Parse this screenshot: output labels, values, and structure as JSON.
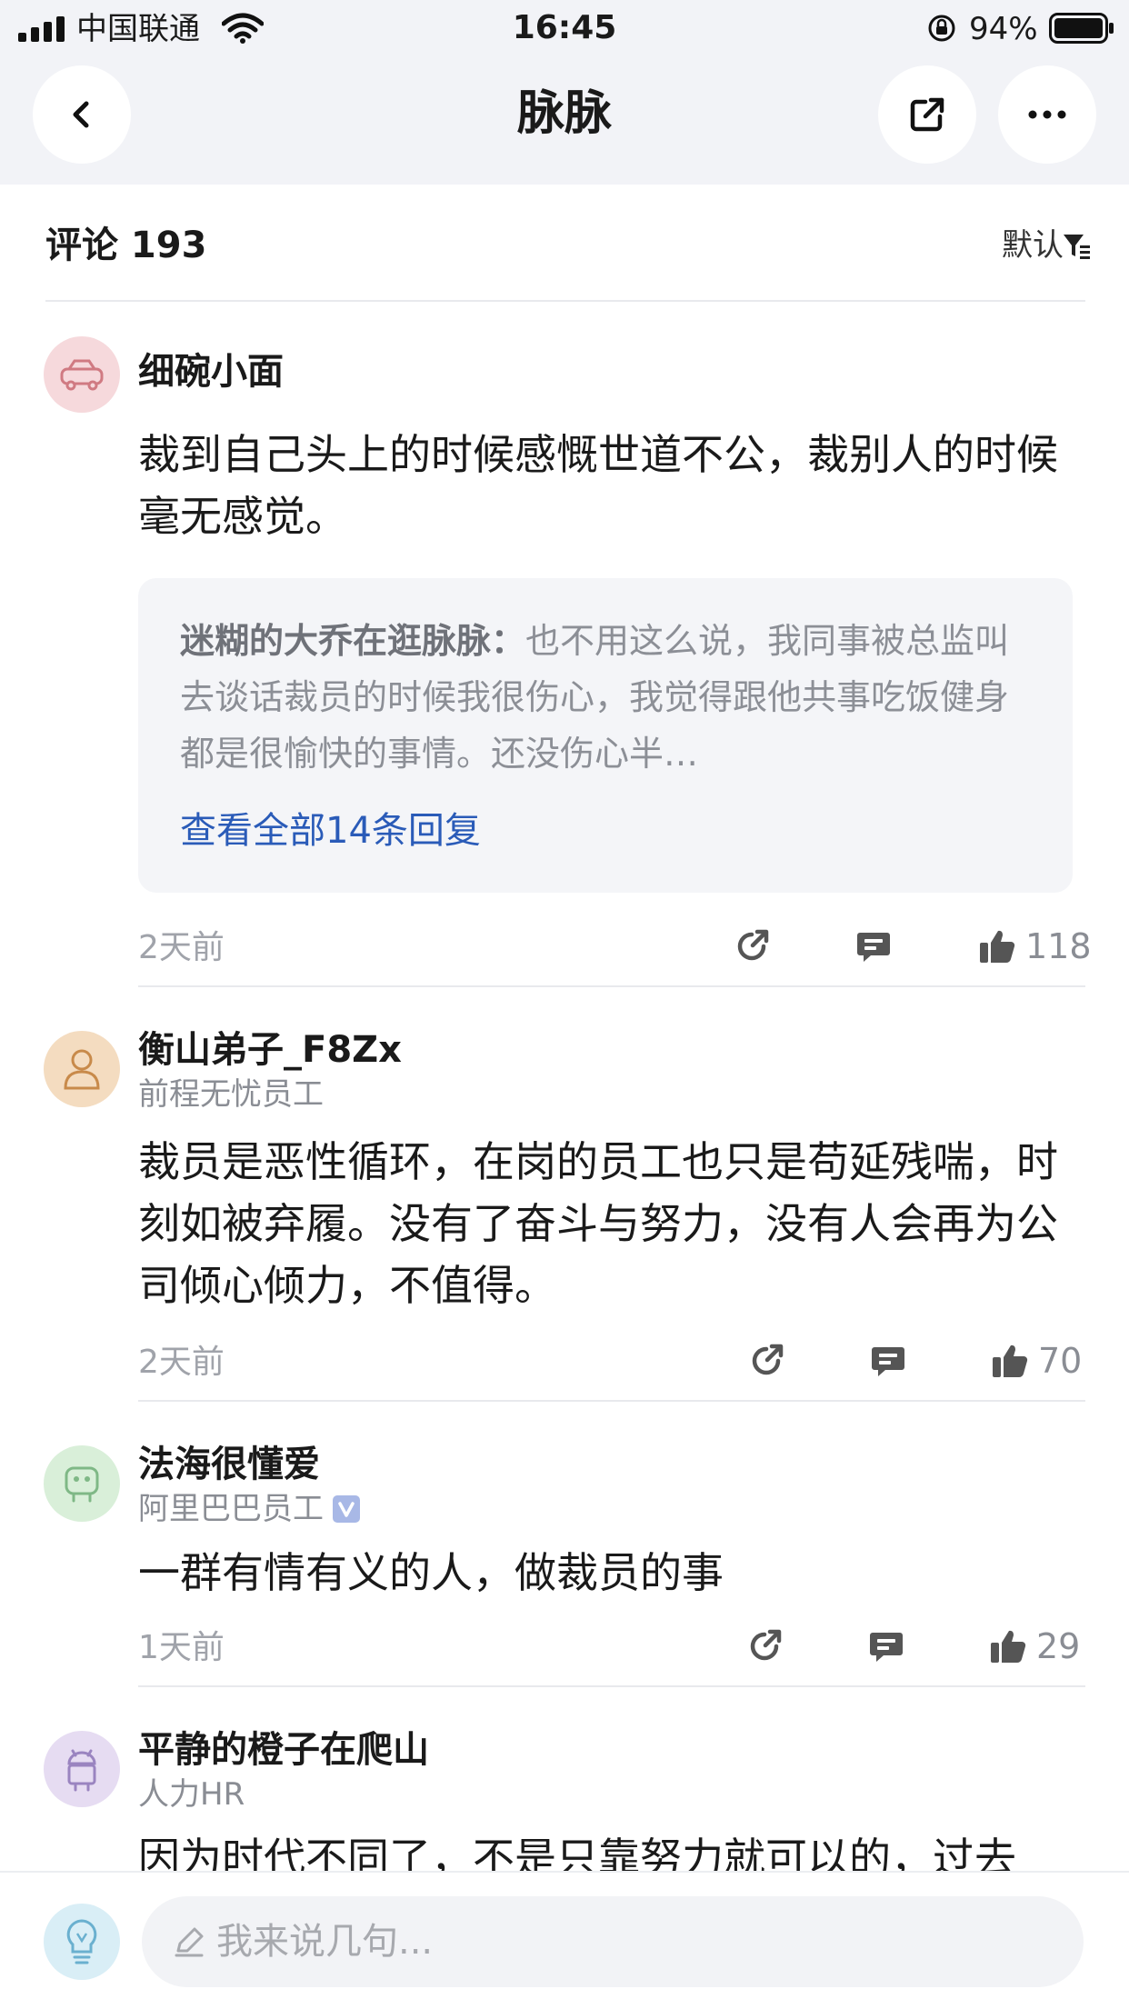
{
  "status_bar": {
    "carrier": "中国联通",
    "time": "16:45",
    "battery": "94%"
  },
  "nav": {
    "title": "脉脉",
    "back_icon": "chevron-left-icon",
    "share_icon": "external-share-icon",
    "more_icon": "more-dots-icon"
  },
  "header": {
    "comment_count": "评论 193",
    "sort_label": "默认"
  },
  "comments": [
    {
      "name": "细碗小面",
      "subtitle": "",
      "text": "裁到自己头上的时候感慨世道不公，裁别人的时候毫无感觉。",
      "reply": {
        "author": "迷糊的大乔在逛脉脉：",
        "text": "也不用这么说，我同事被总监叫去谈话裁员的时候我很伤心，我觉得跟他共事吃饭健身都是很愉快的事情。还没伤心半…",
        "more": "查看全部14条回复"
      },
      "time": "2天前",
      "likes": "118"
    },
    {
      "name": "衡山弟子_F8Zx",
      "subtitle": "前程无忧员工",
      "text": "裁员是恶性循环，在岗的员工也只是苟延残喘，时刻如被弃履。没有了奋斗与努力，没有人会再为公司倾心倾力，不值得。",
      "time": "2天前",
      "likes": "70"
    },
    {
      "name": "法海很懂爱",
      "subtitle": "阿里巴巴员工",
      "text": "一群有情有义的人，做裁员的事",
      "time": "1天前",
      "likes": "29"
    },
    {
      "name": "平静的橙子在爬山",
      "subtitle": "人力HR",
      "text": "因为时代不同了，不是只靠努力就可以的，过去"
    }
  ],
  "input": {
    "placeholder": "我来说几句..."
  },
  "colors": {
    "link": "#2a5bb8",
    "background_top": "#f2f3f7",
    "muted_text": "#8a8d94"
  }
}
